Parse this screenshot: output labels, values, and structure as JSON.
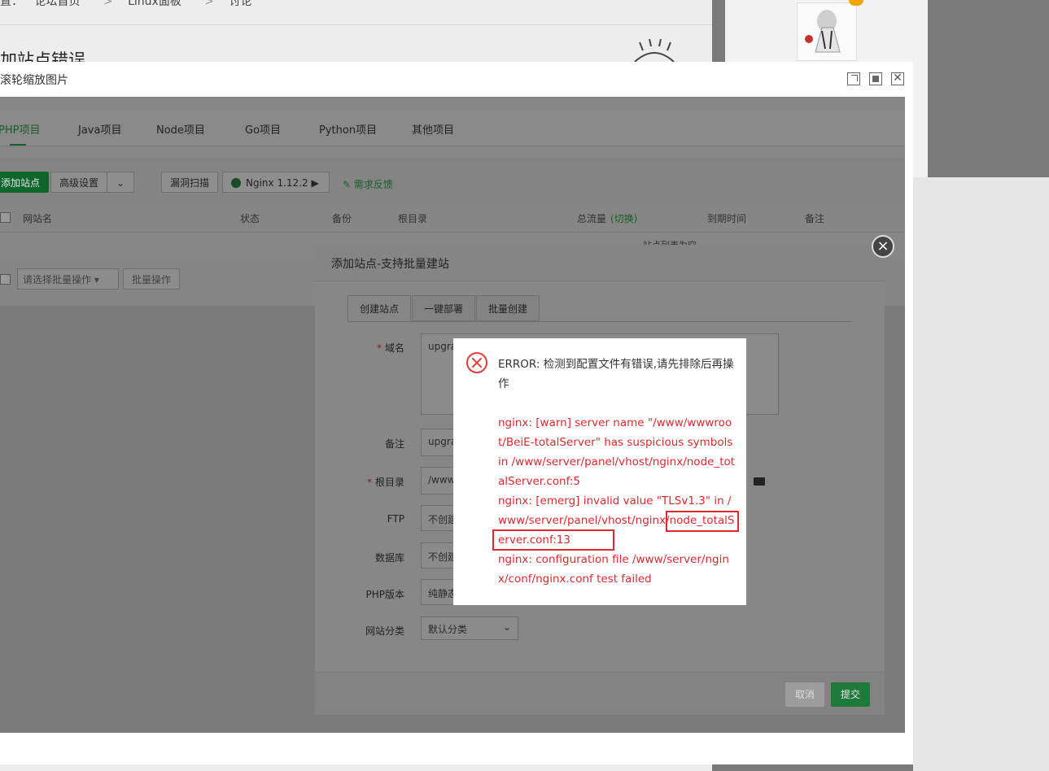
{
  "forum": {
    "breadcrumb": [
      "置：",
      "论坛首页",
      "Linux面板",
      "讨论"
    ],
    "page_title": "加站点错误"
  },
  "viewer": {
    "title": "滚轮缩放图片",
    "close_glyph": "✕"
  },
  "panel": {
    "tabs": [
      "PHP项目",
      "Java项目",
      "Node项目",
      "Go项目",
      "Python项目",
      "其他项目"
    ],
    "toolbar": {
      "add_site": "添加站点",
      "advanced": "高级设置",
      "vuln_scan": "漏洞扫描",
      "nginx": "Nginx 1.12.2",
      "feedback": "需求反馈"
    },
    "table_headers": [
      "网站名",
      "状态",
      "备份",
      "根目录",
      "总流量",
      "(切换)",
      "到期时间",
      "备注"
    ],
    "empty_text": "站点列表为空",
    "batch_select_placeholder": "请选择批量操作",
    "batch_button": "批量操作"
  },
  "add_site_dialog": {
    "title": "添加站点-支持批量建站",
    "close_glyph": "×",
    "tabs": [
      "创建站点",
      "一键部署",
      "批量创建"
    ],
    "fields": {
      "domain_label": "域名",
      "domain_value": "upgra",
      "remark_label": "备注",
      "remark_value": "upgra",
      "root_label": "根目录",
      "root_value": "/www",
      "ftp_label": "FTP",
      "ftp_value": "不创建",
      "db_label": "数据库",
      "db_value": "不创建",
      "php_label": "PHP版本",
      "php_value": "纯静态",
      "category_label": "网站分类",
      "category_value": "默认分类"
    },
    "cancel": "取消",
    "submit": "提交"
  },
  "error_dialog": {
    "title": "ERROR: 检测到配置文件有错误,请先排除后再操作",
    "lines": [
      "nginx: [warn] server name \"/www/wwwroot/BeiE-totalServer\" has suspicious symbols in /www/server/panel/vhost/nginx/node_totalServer.conf:5",
      "nginx: [emerg] invalid value \"TLSv1.3\" in /www/server/panel/vhost/nginx/node_totalServer.conf:13",
      "nginx: configuration file /www/server/nginx/conf/nginx.conf test failed"
    ],
    "error_color": "#e0282e"
  }
}
